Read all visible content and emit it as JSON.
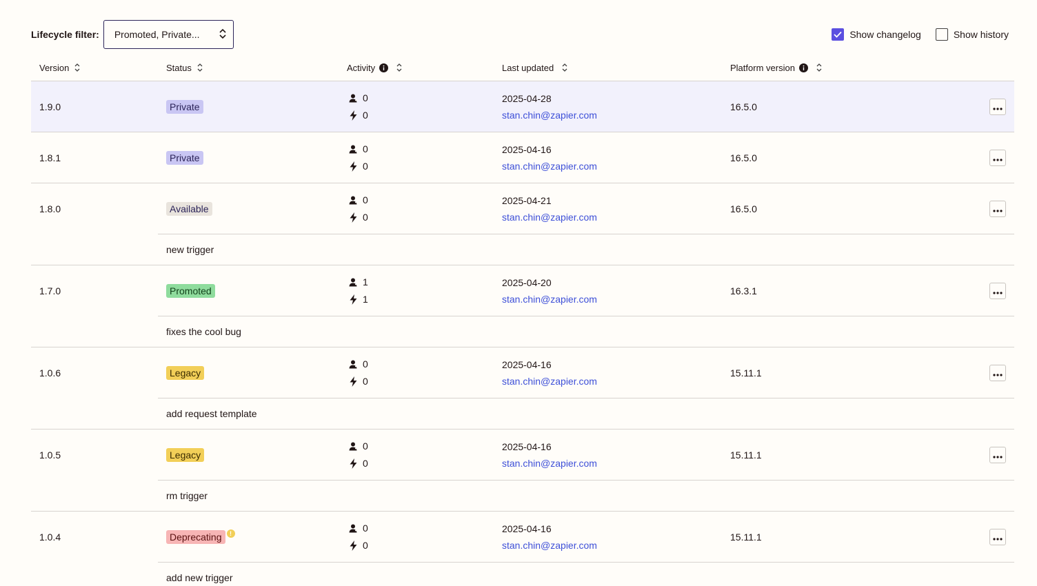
{
  "toolbar": {
    "filter_label": "Lifecycle filter:",
    "filter_value": "Promoted, Private...",
    "show_changelog_label": "Show changelog",
    "show_changelog_checked": true,
    "show_history_label": "Show history",
    "show_history_checked": false
  },
  "columns": {
    "version": "Version",
    "status": "Status",
    "activity": "Activity",
    "last_updated": "Last updated",
    "platform_version": "Platform version"
  },
  "rows": [
    {
      "version": "1.9.0",
      "status": "Private",
      "status_kind": "private",
      "users": "0",
      "zaps": "0",
      "date": "2025-04-28",
      "email": "stan.chin@zapier.com",
      "platform": "16.5.0",
      "changelog": ""
    },
    {
      "version": "1.8.1",
      "status": "Private",
      "status_kind": "private",
      "users": "0",
      "zaps": "0",
      "date": "2025-04-16",
      "email": "stan.chin@zapier.com",
      "platform": "16.5.0",
      "changelog": ""
    },
    {
      "version": "1.8.0",
      "status": "Available",
      "status_kind": "available",
      "users": "0",
      "zaps": "0",
      "date": "2025-04-21",
      "email": "stan.chin@zapier.com",
      "platform": "16.5.0",
      "changelog": "new trigger"
    },
    {
      "version": "1.7.0",
      "status": "Promoted",
      "status_kind": "promoted",
      "users": "1",
      "zaps": "1",
      "date": "2025-04-20",
      "email": "stan.chin@zapier.com",
      "platform": "16.3.1",
      "changelog": "fixes the cool bug"
    },
    {
      "version": "1.0.6",
      "status": "Legacy",
      "status_kind": "legacy",
      "users": "0",
      "zaps": "0",
      "date": "2025-04-16",
      "email": "stan.chin@zapier.com",
      "platform": "15.11.1",
      "changelog": "add request template"
    },
    {
      "version": "1.0.5",
      "status": "Legacy",
      "status_kind": "legacy",
      "users": "0",
      "zaps": "0",
      "date": "2025-04-16",
      "email": "stan.chin@zapier.com",
      "platform": "15.11.1",
      "changelog": "rm trigger"
    },
    {
      "version": "1.0.4",
      "status": "Deprecating",
      "status_kind": "deprecating",
      "users": "0",
      "zaps": "0",
      "date": "2025-04-16",
      "email": "stan.chin@zapier.com",
      "platform": "15.11.1",
      "changelog": "add new trigger",
      "warning": true
    }
  ],
  "colors": {
    "accent": "#5b4fe0",
    "link": "#3d4fd8",
    "highlight_row": "#f2f1fc"
  }
}
